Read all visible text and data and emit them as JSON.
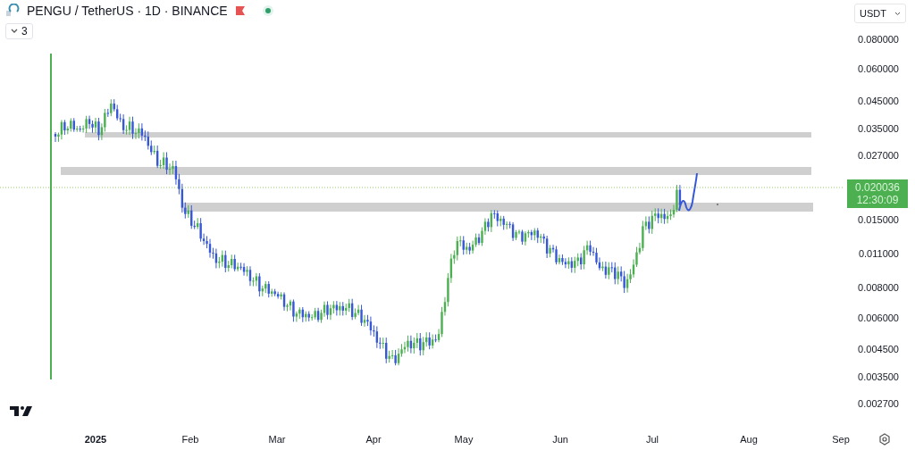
{
  "header": {
    "title": "PENGU / TetherUS · 1D · BINANCE",
    "indicator_count": "3"
  },
  "currency": "USDT",
  "price_axis": [
    "0.080000",
    "0.060000",
    "0.045000",
    "0.035000",
    "0.027000",
    "0.015000",
    "0.011000",
    "0.008000",
    "0.006000",
    "0.004500",
    "0.003500",
    "0.002700"
  ],
  "last_price": {
    "value": "0.020036",
    "countdown": "12:30:09"
  },
  "time_axis": [
    {
      "label": "2025",
      "kind": "year"
    },
    {
      "label": "Feb",
      "kind": "month"
    },
    {
      "label": "Mar",
      "kind": "month"
    },
    {
      "label": "Apr",
      "kind": "month"
    },
    {
      "label": "May",
      "kind": "month"
    },
    {
      "label": "Jun",
      "kind": "month"
    },
    {
      "label": "Jul",
      "kind": "month"
    },
    {
      "label": "Aug",
      "kind": "month"
    },
    {
      "label": "Sep",
      "kind": "month"
    }
  ]
}
